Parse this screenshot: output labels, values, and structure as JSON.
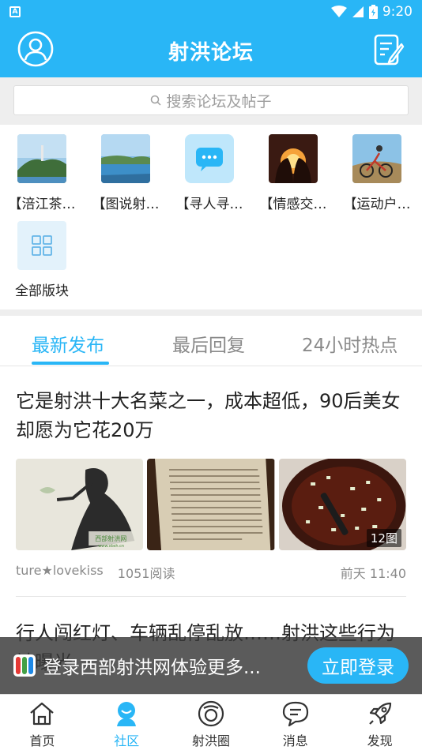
{
  "status_bar": {
    "time": "9:20",
    "app_badge": "A"
  },
  "header": {
    "title": "射洪论坛",
    "user_icon": "user-circle-icon",
    "post_icon": "edit-note-icon"
  },
  "search": {
    "placeholder": "搜索论坛及帖子"
  },
  "forums": [
    {
      "label": "【涪江茶…",
      "thumb": "landscape-tower"
    },
    {
      "label": "【图说射…",
      "thumb": "lake-landscape"
    },
    {
      "label": "【寻人寻…",
      "thumb": "chat-bubble-icon"
    },
    {
      "label": "【情感交…",
      "thumb": "couple-sunset"
    },
    {
      "label": "【运动户…",
      "thumb": "mountain-bike"
    },
    {
      "label": "全部版块",
      "thumb": "grid-icon"
    }
  ],
  "tabs": [
    {
      "label": "最新发布",
      "active": true
    },
    {
      "label": "最后回复",
      "active": false
    },
    {
      "label": "24小时热点",
      "active": false
    }
  ],
  "posts": [
    {
      "title": "它是射洪十大名菜之一，成本超低，90后美女却愿为它花20万",
      "image_count": "12图",
      "author": "ture★lovekiss",
      "views": "1051阅读",
      "time": "前天 11:40",
      "watermark": "西部射洪网",
      "watermark_url": "www.xbsh.cn"
    },
    {
      "title": "行人闯红灯、车辆乱停乱放……射洪这些行为被曝光"
    }
  ],
  "login_banner": {
    "message": "登录西部射洪网体验更多...",
    "button": "立即登录"
  },
  "bottom_nav": [
    {
      "label": "首页",
      "icon": "home-icon",
      "active": false
    },
    {
      "label": "社区",
      "icon": "community-icon",
      "active": true
    },
    {
      "label": "射洪圈",
      "icon": "circle-icon",
      "active": false
    },
    {
      "label": "消息",
      "icon": "message-icon",
      "active": false
    },
    {
      "label": "发现",
      "icon": "rocket-icon",
      "active": false
    }
  ],
  "colors": {
    "primary": "#29b6f6",
    "text": "#222222",
    "muted": "#8a8a8a"
  }
}
